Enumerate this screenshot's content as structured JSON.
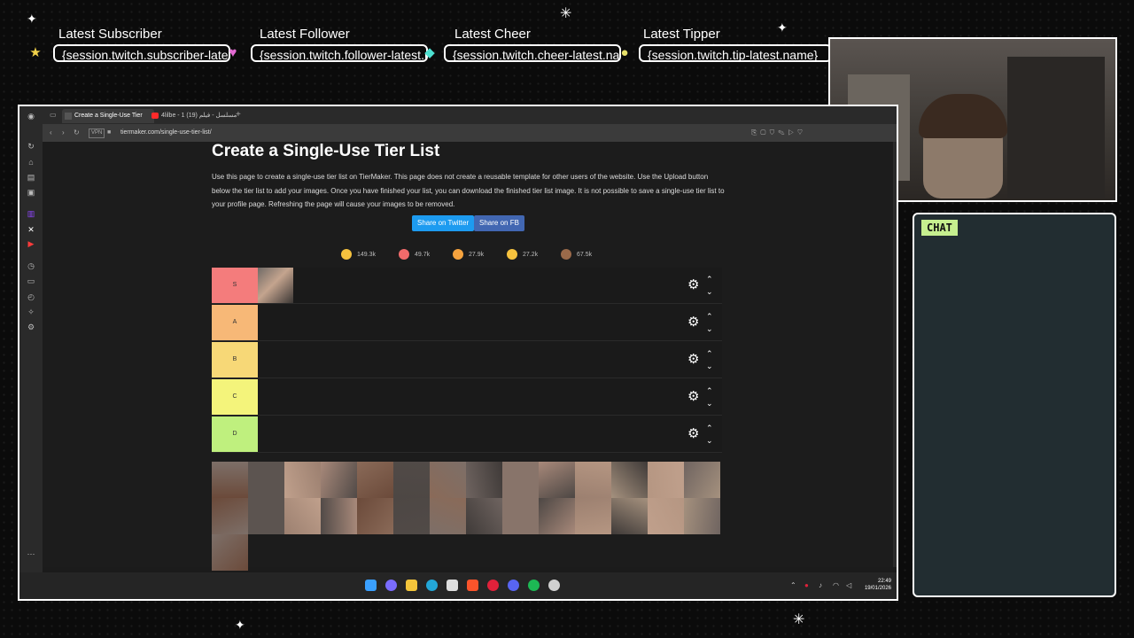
{
  "overlay": {
    "alerts": [
      {
        "title": "Latest Subscriber",
        "value": "{session.twitch.subscriber-latest.name}",
        "gem": "★",
        "gem_color": "#f2d24a"
      },
      {
        "title": "Latest Follower",
        "value": "{session.twitch.follower-latest.name}",
        "gem": "♥",
        "gem_color": "#e46bd3"
      },
      {
        "title": "Latest Cheer",
        "value": "{session.twitch.cheer-latest.name}",
        "gem": "◆",
        "gem_color": "#4de0d0"
      },
      {
        "title": "Latest Tipper",
        "value": "{session.twitch.tip-latest.name}",
        "gem": "●",
        "gem_color": "#e6e06a"
      }
    ],
    "chat_label": "CHAT"
  },
  "browser": {
    "tabs": [
      {
        "label": "Create a Single-Use Tier",
        "active": true
      },
      {
        "label": "4lilbe - 1 مسلسل - فيلم (19)",
        "active": false
      }
    ],
    "url": "tiermaker.com/single-use-tier-list/",
    "vpn_label": "VPN"
  },
  "page": {
    "title": "Create a Single-Use Tier List",
    "description": "Use this page to create a single-use tier list on TierMaker. This page does not create a reusable template for other users of the website. Use the Upload button below the tier list to add your images. Once you have finished your list, you can download the finished tier list image. It is not possible to save a single-use tier list to your profile page. Refreshing the page will cause your images to be removed.",
    "share_twitter": "Share on Twitter",
    "share_fb": "Share on FB",
    "reactions": [
      {
        "icon": "laugh-emoji-icon",
        "count": "149.3k",
        "color": "#f6c23e"
      },
      {
        "icon": "heart-eyes-emoji-icon",
        "count": "49.7k",
        "color": "#f26b6b"
      },
      {
        "icon": "grin-emoji-icon",
        "count": "27.9k",
        "color": "#f6a33e"
      },
      {
        "icon": "praise-hands-emoji-icon",
        "count": "27.2k",
        "color": "#f6c23e"
      },
      {
        "icon": "poop-emoji-icon",
        "count": "67.5k",
        "color": "#9b6a4a"
      }
    ],
    "tiers": [
      {
        "label": "S",
        "color": "#f47c7c"
      },
      {
        "label": "A",
        "color": "#f7b877"
      },
      {
        "label": "B",
        "color": "#f7d877"
      },
      {
        "label": "C",
        "color": "#f4f47b"
      },
      {
        "label": "D",
        "color": "#bff07e"
      }
    ]
  },
  "taskbar": {
    "time": "22:49",
    "date": "19/01/2026"
  }
}
